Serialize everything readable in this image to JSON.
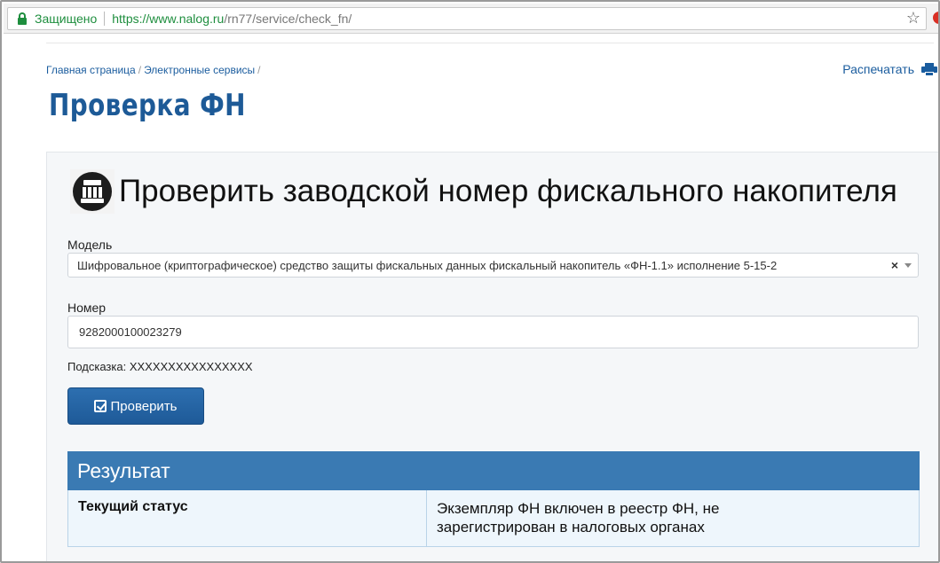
{
  "browser": {
    "secure_label": "Защищено",
    "url_main": "https://www.nalog.ru",
    "url_rest": "/rn77/service/check_fn/",
    "bookmark_icon": "star-icon"
  },
  "breadcrumb": {
    "items": [
      "Главная страница",
      "Электронные сервисы"
    ],
    "separator": "/"
  },
  "print_label": "Распечатать",
  "page_title": "Проверка ФН",
  "form": {
    "heading": "Проверить заводской номер фискального накопителя",
    "model_label": "Модель",
    "model_value": "Шифровальное (криптографическое) средство защиты фискальных данных фискальный накопитель «ФН-1.1» исполнение 5-15-2",
    "clear_symbol": "×",
    "number_label": "Номер",
    "number_value": "9282000100023279",
    "hint_text": "Подсказка: XXXXXXXXXXXXXXXX",
    "submit_label": "Проверить"
  },
  "result": {
    "title": "Результат",
    "status_key": "Текущий статус",
    "status_value_line1": "Экземпляр ФН включен в реестр ФН, не",
    "status_value_line2": "зарегистрирован в налоговых органах"
  },
  "colors": {
    "brand_blue": "#1d5a97",
    "button_blue": "#1e5a98",
    "result_header": "#3a7ab3",
    "secure_green": "#1e8e3e"
  }
}
